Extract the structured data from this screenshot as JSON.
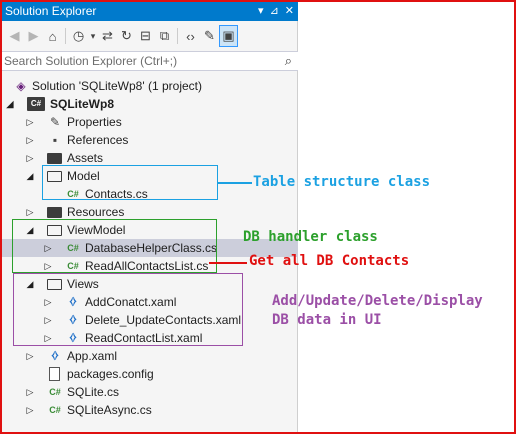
{
  "panel": {
    "title": "Solution Explorer",
    "title_controls": [
      "▾",
      "📌",
      "✕"
    ],
    "search_placeholder": "Search Solution Explorer (Ctrl+;)"
  },
  "tree": {
    "solution": "Solution 'SQLiteWp8' (1 project)",
    "project": "SQLiteWp8",
    "properties": "Properties",
    "references": "References",
    "assets": "Assets",
    "model": "Model",
    "contacts": "Contacts.cs",
    "resources": "Resources",
    "viewmodel": "ViewModel",
    "dbhelper": "DatabaseHelperClass.cs",
    "readall": "ReadAllContactsList.cs",
    "views": "Views",
    "addcontact": "AddConatct.xaml",
    "delete": "Delete_UpdateContacts.xaml",
    "readcontact": "ReadContactList.xaml",
    "app": "App.xaml",
    "packages": "packages.config",
    "sqlite": "SQLite.cs",
    "sqliteasync": "SQLiteAsync.cs"
  },
  "annotations": {
    "table": "Table structure class",
    "handler": "DB handler class",
    "getall": "Get all DB Contacts",
    "ui_line1": "Add/Update/Delete/Display",
    "ui_line2": "DB data in UI"
  },
  "colors": {
    "accent": "#007acc",
    "frame": "#e01010",
    "model_box": "#1ba1e2",
    "viewmodel_box": "#2ca02c",
    "views_box": "#9b4fa6",
    "getall": "#e01010"
  }
}
